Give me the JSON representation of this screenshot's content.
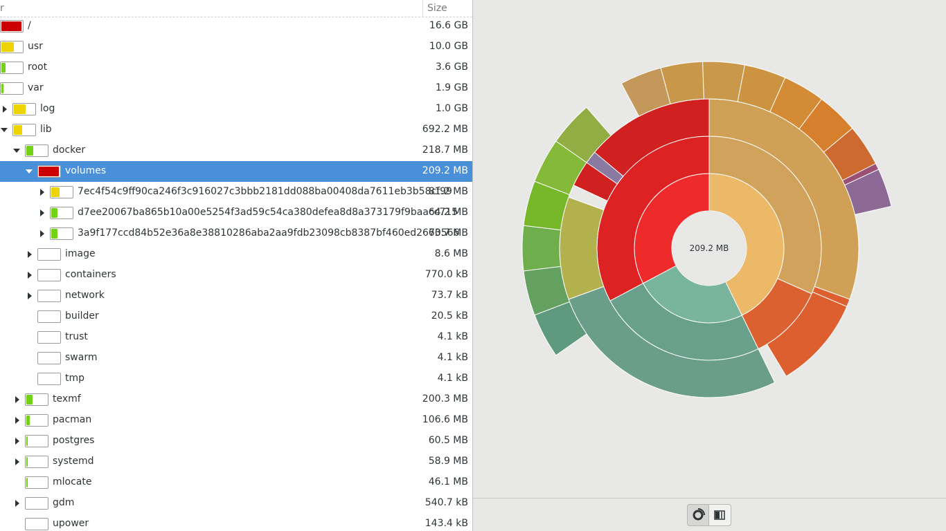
{
  "tree": {
    "header": {
      "name_col": "r",
      "size_col": "Size"
    },
    "rows": [
      {
        "name": "/",
        "size": "16.6 GB",
        "level": 0,
        "expander": "none",
        "fill": 0.95,
        "color": "#cc0000"
      },
      {
        "name": "usr",
        "size": "10.0 GB",
        "level": 1,
        "expander": "none",
        "fill": 0.6,
        "color": "#edd400"
      },
      {
        "name": "root",
        "size": "3.6 GB",
        "level": 1,
        "expander": "none",
        "fill": 0.2,
        "color": "#73d216"
      },
      {
        "name": "var",
        "size": "1.9 GB",
        "level": 1,
        "expander": "none",
        "fill": 0.1,
        "color": "#73d216"
      },
      {
        "name": "log",
        "size": "1.0 GB",
        "level": 2,
        "expander": "collapsed",
        "fill": 0.55,
        "color": "#edd400"
      },
      {
        "name": "lib",
        "size": "692.2 MB",
        "level": 2,
        "expander": "expanded",
        "fill": 0.4,
        "color": "#edd400"
      },
      {
        "name": "docker",
        "size": "218.7 MB",
        "level": 3,
        "expander": "expanded",
        "fill": 0.32,
        "color": "#73d216"
      },
      {
        "name": "volumes",
        "size": "209.2 MB",
        "level": 4,
        "expander": "expanded",
        "fill": 0.96,
        "color": "#cc0000",
        "selected": true
      },
      {
        "name": "7ec4f54c9ff90ca246f3c916027c3bbb2181dd088ba00408da7611eb3b58cf99",
        "size": "81.2 MB",
        "level": 5,
        "expander": "collapsed",
        "fill": 0.39,
        "color": "#edd400"
      },
      {
        "name": "d7ee20067ba865b10a00e5254f3ad59c54ca380defea8d8a373179f9baacc715",
        "size": "64.2 MB",
        "level": 5,
        "expander": "collapsed",
        "fill": 0.31,
        "color": "#73d216"
      },
      {
        "name": "3a9f177ccd84b52e36a8e38810286aba2aa9fdb23098cb8387bf460ed2670566",
        "size": "63.7 MB",
        "level": 5,
        "expander": "collapsed",
        "fill": 0.3,
        "color": "#73d216"
      },
      {
        "name": "image",
        "size": "8.6 MB",
        "level": 4,
        "expander": "collapsed",
        "fill": 0,
        "color": "#73d216"
      },
      {
        "name": "containers",
        "size": "770.0 kB",
        "level": 4,
        "expander": "collapsed",
        "fill": 0,
        "color": "#73d216"
      },
      {
        "name": "network",
        "size": "73.7 kB",
        "level": 4,
        "expander": "collapsed",
        "fill": 0,
        "color": "#73d216"
      },
      {
        "name": "builder",
        "size": "20.5 kB",
        "level": 4,
        "expander": "none",
        "fill": 0,
        "color": "#73d216"
      },
      {
        "name": "trust",
        "size": "4.1 kB",
        "level": 4,
        "expander": "none",
        "fill": 0,
        "color": "#73d216"
      },
      {
        "name": "swarm",
        "size": "4.1 kB",
        "level": 4,
        "expander": "none",
        "fill": 0,
        "color": "#73d216"
      },
      {
        "name": "tmp",
        "size": "4.1 kB",
        "level": 4,
        "expander": "none",
        "fill": 0,
        "color": "#73d216"
      },
      {
        "name": "texmf",
        "size": "200.3 MB",
        "level": 3,
        "expander": "collapsed",
        "fill": 0.29,
        "color": "#73d216"
      },
      {
        "name": "pacman",
        "size": "106.6 MB",
        "level": 3,
        "expander": "collapsed",
        "fill": 0.15,
        "color": "#73d216"
      },
      {
        "name": "postgres",
        "size": "60.5 MB",
        "level": 3,
        "expander": "collapsed",
        "fill": 0.08,
        "color": "#73d216"
      },
      {
        "name": "systemd",
        "size": "58.9 MB",
        "level": 3,
        "expander": "collapsed",
        "fill": 0.08,
        "color": "#73d216"
      },
      {
        "name": "mlocate",
        "size": "46.1 MB",
        "level": 3,
        "expander": "none",
        "fill": 0.06,
        "color": "#73d216"
      },
      {
        "name": "gdm",
        "size": "540.7 kB",
        "level": 3,
        "expander": "collapsed",
        "fill": 0,
        "color": "#73d216"
      },
      {
        "name": "upower",
        "size": "143.4 kB",
        "level": 3,
        "expander": "none",
        "fill": 0,
        "color": "#73d216"
      }
    ]
  },
  "chart": {
    "center_label": "209.2 MB",
    "rings": [
      [
        {
          "start": -90,
          "sweep": 154,
          "color": "#ebb968"
        },
        {
          "start": 64,
          "sweep": 88,
          "color": "#79b49d"
        },
        {
          "start": 152,
          "sweep": 118,
          "color": "#ee2a2a"
        }
      ],
      [
        {
          "start": -90,
          "sweep": 114,
          "color": "#d1a25b"
        },
        {
          "start": 24,
          "sweep": 40,
          "color": "#db6230"
        },
        {
          "start": 64,
          "sweep": 88,
          "color": "#69a08c"
        },
        {
          "start": 152,
          "sweep": 118,
          "color": "#dc2222"
        }
      ],
      [
        {
          "start": -90,
          "sweep": 110,
          "color": "#d0a056"
        },
        {
          "start": 20,
          "sweep": 3,
          "color": "#dd5f30"
        },
        {
          "start": 23,
          "sweep": 36,
          "color": "#dd5f30"
        },
        {
          "start": 64,
          "sweep": 96,
          "color": "#6a9d8a"
        },
        {
          "start": 160,
          "sweep": 40,
          "color": "#b3b14e"
        },
        {
          "start": 205,
          "sweep": 65,
          "color": "#d12020"
        },
        {
          "start": -145,
          "sweep": 5,
          "color": "#8a7aa2"
        }
      ],
      [
        {
          "start": -90,
          "sweep": 5,
          "color": "#d24a2c"
        },
        {
          "start": -85,
          "sweep": 7,
          "color": "#c41e1e"
        },
        {
          "start": -78,
          "sweep": 13,
          "color": "#c4303d"
        },
        {
          "start": -65,
          "sweep": 14,
          "color": "#b53a4a"
        },
        {
          "start": -51,
          "sweep": 13,
          "color": "#a84257"
        },
        {
          "start": -38,
          "sweep": 13,
          "color": "#9a5075"
        },
        {
          "start": -25,
          "sweep": 12,
          "color": "#8d6a95"
        }
      ]
    ],
    "outer_left": [
      {
        "start": 145,
        "sweep": 14,
        "color": "#5f9a7e"
      },
      {
        "start": 159,
        "sweep": 14,
        "color": "#64a060"
      },
      {
        "start": 173,
        "sweep": 14,
        "color": "#6fae4c"
      },
      {
        "start": 187,
        "sweep": 14,
        "color": "#76b82a"
      },
      {
        "start": 201,
        "sweep": 14,
        "color": "#84b93a"
      },
      {
        "start": 215,
        "sweep": 14,
        "color": "#92ad44"
      }
    ],
    "outer_top": [
      {
        "start": -118,
        "sweep": 13,
        "color": "#c4975a"
      },
      {
        "start": -105,
        "sweep": 13,
        "color": "#c9974a"
      },
      {
        "start": -92,
        "sweep": 13,
        "color": "#c9984a"
      },
      {
        "start": -79,
        "sweep": 13,
        "color": "#cc9440"
      },
      {
        "start": -66,
        "sweep": 13,
        "color": "#d38b35"
      },
      {
        "start": -53,
        "sweep": 13,
        "color": "#d6802e"
      },
      {
        "start": -40,
        "sweep": 13,
        "color": "#cd6a2f"
      }
    ]
  },
  "toolbar": {
    "ring_icon": "rings-chart-icon",
    "tree_icon": "treemap-chart-icon"
  }
}
